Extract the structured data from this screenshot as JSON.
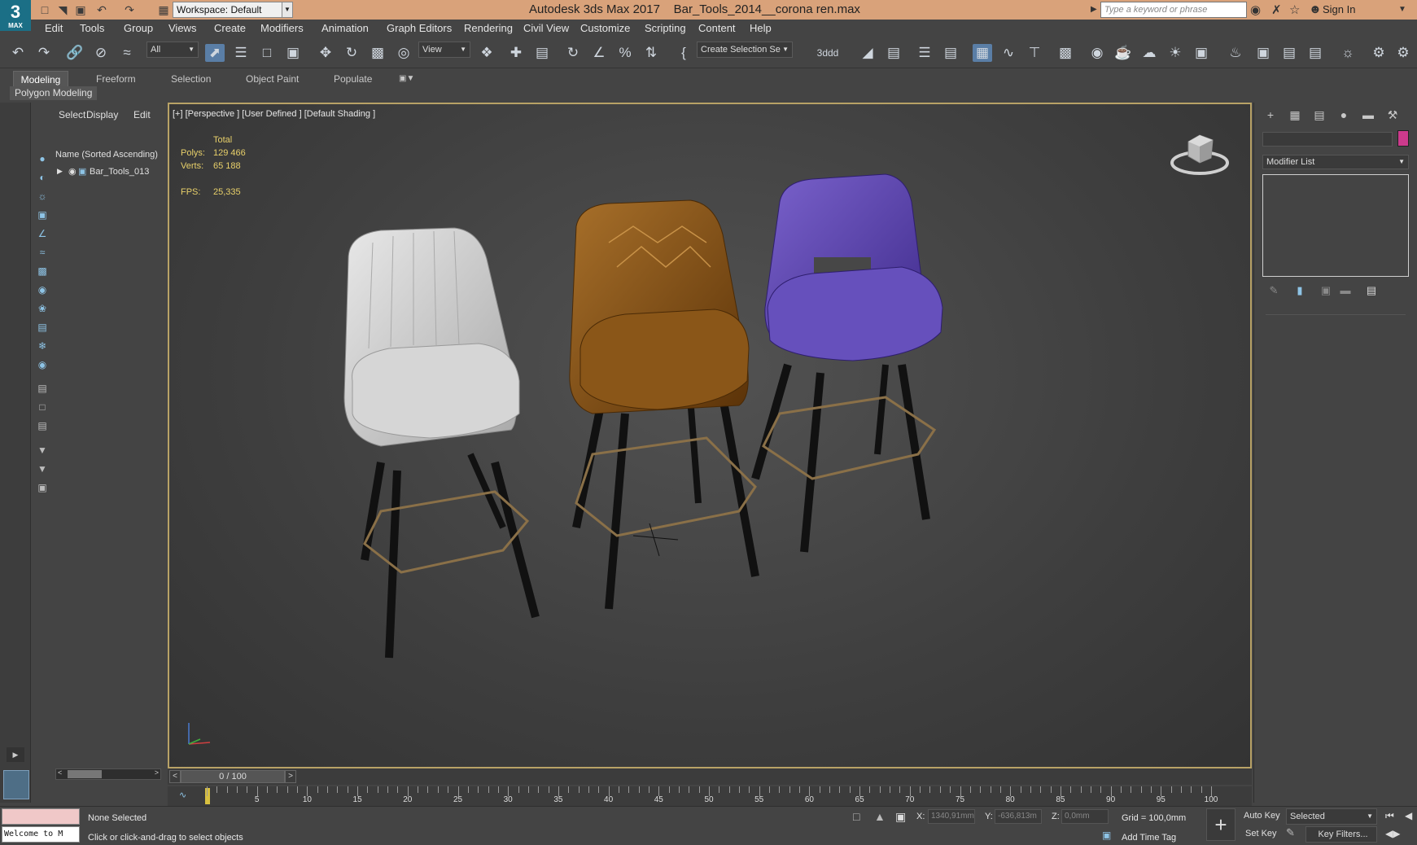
{
  "app": {
    "logo_number": "3",
    "logo_text": "MAX",
    "title": "Autodesk 3ds Max 2017    Bar_Tools_2014__corona ren.max",
    "workspace": "Workspace: Default",
    "search_placeholder": "Type a keyword or phrase",
    "sign_in": "Sign In"
  },
  "menu": [
    "Edit",
    "Tools",
    "Group",
    "Views",
    "Create",
    "Modifiers",
    "Animation",
    "Graph Editors",
    "Rendering",
    "Civil View",
    "Customize",
    "Scripting",
    "Content",
    "Help"
  ],
  "toolbar": {
    "filter": "All",
    "ref_coord": "View",
    "selection_set": "Create Selection Se",
    "label_3ddd": "3ddd"
  },
  "ribbon": {
    "tabs": [
      "Modeling",
      "Freeform",
      "Selection",
      "Object Paint",
      "Populate"
    ],
    "panel": "Polygon Modeling"
  },
  "explorer": {
    "menu": [
      "Select",
      "Display",
      "Edit"
    ],
    "column": "Name (Sorted Ascending)",
    "item": "Bar_Tools_013"
  },
  "viewport": {
    "label": "[+] [Perspective ] [User Defined ] [Default Shading ]",
    "stats": {
      "total_label": "Total",
      "polys_label": "Polys:",
      "polys": "129 466",
      "verts_label": "Verts:",
      "verts": "65 188",
      "fps_label": "FPS:",
      "fps": "25,335"
    }
  },
  "command_panel": {
    "modifier_list": "Modifier List"
  },
  "timeline": {
    "frame": "0 / 100",
    "labels": [
      "5",
      "10",
      "15",
      "20",
      "25",
      "30",
      "35",
      "40",
      "45",
      "50",
      "55",
      "60",
      "65",
      "70",
      "75",
      "80",
      "85",
      "90",
      "95",
      "100"
    ]
  },
  "status": {
    "listener": "Welcome to M",
    "selection": "None Selected",
    "prompt": "Click or click-and-drag to select objects",
    "x_label": "X:",
    "x": "1340,91mm",
    "y_label": "Y:",
    "y": "-636,813m",
    "z_label": "Z:",
    "z": "0,0mm",
    "grid": "Grid = 100,0mm",
    "add_time_tag": "Add Time Tag",
    "auto_key": "Auto Key",
    "key_mode": "Selected",
    "set_key": "Set Key",
    "key_filters": "Key Filters..."
  },
  "colors": {
    "title_bar": "#d9a27a",
    "viewport_border": "#b8a266",
    "stats": "#e8d06a",
    "object_color": "#cc3a8c",
    "chair_white": "#d4d4d4",
    "chair_brown": "#7a4a12",
    "chair_purple": "#5a3fa8"
  }
}
